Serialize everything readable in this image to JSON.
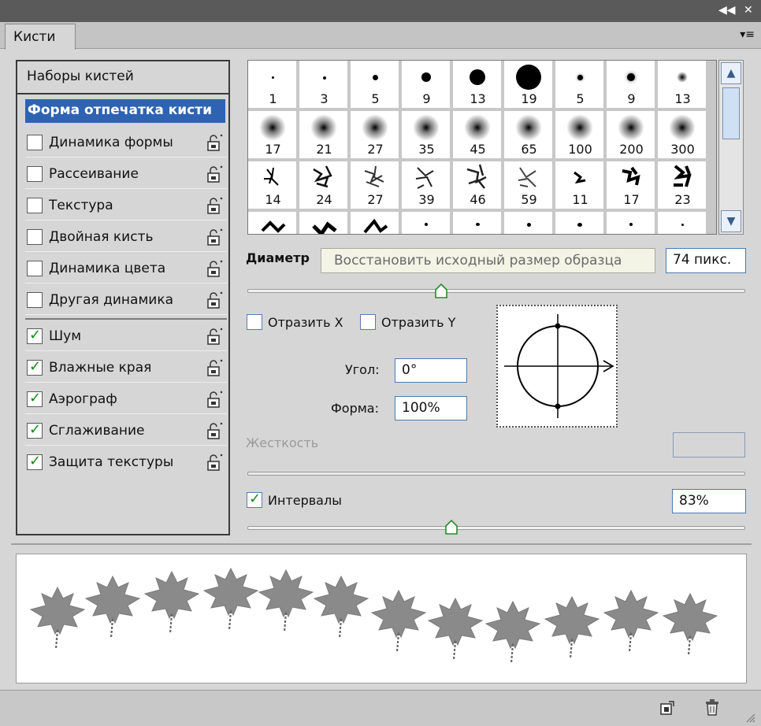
{
  "window": {
    "collapse_icon": "◀◀",
    "close_icon": "✕"
  },
  "tab": {
    "title": "Кисти",
    "menu_icon": "▾≡"
  },
  "left_panel": {
    "presets_label": "Наборы кистей",
    "tip_shape_label": "Форма отпечатка кисти",
    "options": [
      {
        "label": "Динамика формы",
        "checked": false
      },
      {
        "label": "Рассеивание",
        "checked": false
      },
      {
        "label": "Текстура",
        "checked": false
      },
      {
        "label": "Двойная кисть",
        "checked": false
      },
      {
        "label": "Динамика цвета",
        "checked": false
      },
      {
        "label": "Другая динамика",
        "checked": false
      }
    ],
    "extras": [
      {
        "label": "Шум",
        "checked": true
      },
      {
        "label": "Влажные края",
        "checked": true
      },
      {
        "label": "Аэрограф",
        "checked": true
      },
      {
        "label": "Сглаживание",
        "checked": true
      },
      {
        "label": "Защита текстуры",
        "checked": true
      }
    ]
  },
  "brush_grid": {
    "row1": [
      "1",
      "3",
      "5",
      "9",
      "13",
      "19",
      "5",
      "9",
      "13"
    ],
    "row2": [
      "17",
      "21",
      "27",
      "35",
      "45",
      "65",
      "100",
      "200",
      "300"
    ],
    "row3": [
      "14",
      "24",
      "27",
      "39",
      "46",
      "59",
      "11",
      "17",
      "23"
    ]
  },
  "diameter": {
    "label": "Диаметр",
    "tooltip": "Восстановить исходный размер образца",
    "value": "74 пикс.",
    "slider_fraction": 0.39
  },
  "flip": {
    "x_label": "Отразить X",
    "y_label": "Отразить Y"
  },
  "angle": {
    "label": "Угол:",
    "value": "0°"
  },
  "roundness": {
    "label": "Форма:",
    "value": "100%"
  },
  "hardness": {
    "label": "Жесткость",
    "value": ""
  },
  "spacing": {
    "label": "Интервалы",
    "checked": true,
    "value": "83%",
    "slider_fraction": 0.41
  },
  "colors": {
    "selection": "#2e63b4",
    "check": "#138a13",
    "leaf": "#8a8a8a"
  }
}
